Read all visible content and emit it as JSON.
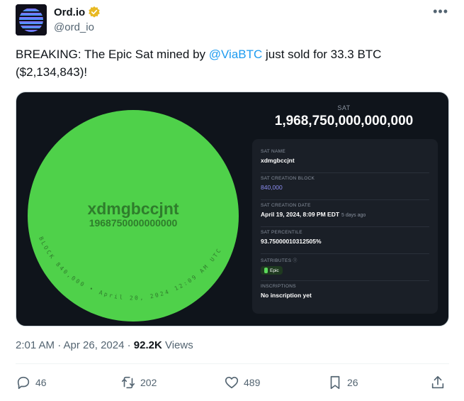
{
  "author": {
    "name": "Ord.io",
    "handle": "@ord_io",
    "verified_color": "#e8b923",
    "avatar_icon": "ord-io-logo"
  },
  "tweet": {
    "text_before": "BREAKING: The Epic Sat mined by ",
    "mention": "@ViaBTC",
    "text_after": " just sold for 33.3 BTC ($2,134,843)!",
    "timestamp": "2:01 AM · Apr 26, 2024 · ",
    "views_count": "92.2K",
    "views_label": " Views"
  },
  "media": {
    "circle_color": "#4fd14a",
    "sat_name_big": "xdmgbccjnt",
    "sat_number_small": "1968750000000000",
    "arc_text": "BLOCK 840,000 • April 20, 2024 12:09 AM UTC",
    "sat_label": "SAT",
    "sat_number": "1,968,750,000,000,000",
    "rows": [
      {
        "key": "SAT NAME",
        "value": "xdmgbccjnt"
      },
      {
        "key": "SAT CREATION BLOCK",
        "value": "840,000"
      },
      {
        "key": "SAT CREATION DATE",
        "value": "April 19, 2024, 8:09 PM EDT",
        "extra": "5 days ago"
      },
      {
        "key": "SAT PERCENTILE",
        "value": "93.75000010312505%"
      },
      {
        "key": "SATRIBUTES",
        "value": "Epic"
      },
      {
        "key": "INSCRIPTIONS",
        "value": "No inscription yet"
      }
    ]
  },
  "actions": {
    "replies": "46",
    "reposts": "202",
    "likes": "489",
    "bookmarks": "26"
  }
}
